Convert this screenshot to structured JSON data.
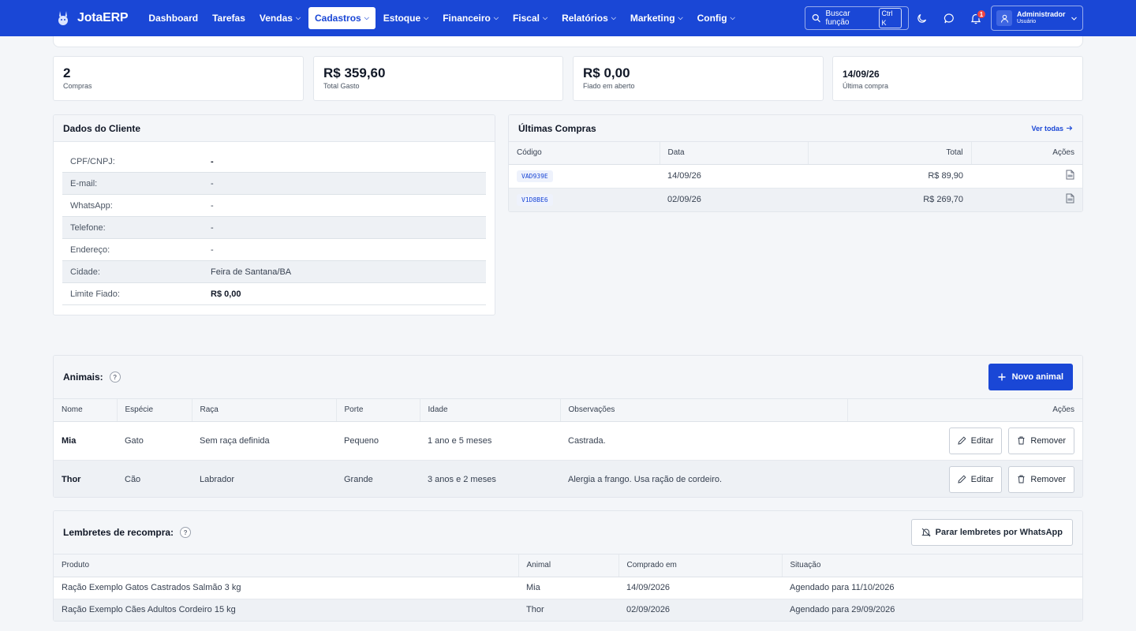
{
  "brand": {
    "name": "JotaERP"
  },
  "nav": {
    "items": [
      {
        "label": "Dashboard",
        "has_menu": false,
        "active": false
      },
      {
        "label": "Tarefas",
        "has_menu": false,
        "active": false
      },
      {
        "label": "Vendas",
        "has_menu": true,
        "active": false
      },
      {
        "label": "Cadastros",
        "has_menu": true,
        "active": true
      },
      {
        "label": "Estoque",
        "has_menu": true,
        "active": false
      },
      {
        "label": "Financeiro",
        "has_menu": true,
        "active": false
      },
      {
        "label": "Fiscal",
        "has_menu": true,
        "active": false
      },
      {
        "label": "Relatórios",
        "has_menu": true,
        "active": false
      },
      {
        "label": "Marketing",
        "has_menu": true,
        "active": false
      },
      {
        "label": "Config",
        "has_menu": true,
        "active": false
      }
    ],
    "search_label": "Buscar função",
    "search_shortcut": "Ctrl K",
    "notifications_count": "1",
    "user_name": "Administrador",
    "user_role": "Usuário"
  },
  "stats": [
    {
      "value": "2",
      "label": "Compras"
    },
    {
      "value": "R$ 359,60",
      "label": "Total Gasto"
    },
    {
      "value": "R$ 0,00",
      "label": "Fiado em aberto"
    },
    {
      "value": "14/09/26",
      "label": "Última compra"
    }
  ],
  "client": {
    "title": "Dados do Cliente",
    "fields": [
      {
        "key": "CPF/CNPJ:",
        "value": "-",
        "bold": true
      },
      {
        "key": "E-mail:",
        "value": "-",
        "bold": false
      },
      {
        "key": "WhatsApp:",
        "value": "-",
        "bold": false
      },
      {
        "key": "Telefone:",
        "value": "-",
        "bold": false
      },
      {
        "key": "Endereço:",
        "value": "-",
        "bold": false
      },
      {
        "key": "Cidade:",
        "value": "Feira de Santana/BA",
        "bold": false
      },
      {
        "key": "Limite Fiado:",
        "value": "R$ 0,00",
        "bold": true
      }
    ]
  },
  "purchases": {
    "title": "Últimas Compras",
    "see_all": "Ver todas",
    "columns": [
      "Código",
      "Data",
      "Total",
      "Ações"
    ],
    "rows": [
      {
        "code": "VAD939E",
        "date": "14/09/26",
        "total": "R$ 89,90"
      },
      {
        "code": "V1D8BE6",
        "date": "02/09/26",
        "total": "R$ 269,70"
      }
    ]
  },
  "animals": {
    "title": "Animais:",
    "add_button": "Novo animal",
    "columns": [
      "Nome",
      "Espécie",
      "Raça",
      "Porte",
      "Idade",
      "Observações",
      "Ações"
    ],
    "edit_label": "Editar",
    "remove_label": "Remover",
    "rows": [
      {
        "name": "Mia",
        "species": "Gato",
        "breed": "Sem raça definida",
        "size": "Pequeno",
        "age": "1 ano e 5 meses",
        "notes": "Castrada."
      },
      {
        "name": "Thor",
        "species": "Cão",
        "breed": "Labrador",
        "size": "Grande",
        "age": "3 anos e 2 meses",
        "notes": "Alergia a frango. Usa ração de cordeiro."
      }
    ]
  },
  "reminders": {
    "title": "Lembretes de recompra:",
    "stop_button": "Parar lembretes por WhatsApp",
    "columns": [
      "Produto",
      "Animal",
      "Comprado em",
      "Situação"
    ],
    "rows": [
      {
        "product": "Ração Exemplo Gatos Castrados Salmão 3 kg",
        "animal": "Mia",
        "bought": "14/09/2026",
        "status": "Agendado para 11/10/2026"
      },
      {
        "product": "Ração Exemplo Cães Adultos Cordeiro 15 kg",
        "animal": "Thor",
        "bought": "02/09/2026",
        "status": "Agendado para 29/09/2026"
      }
    ]
  },
  "colors": {
    "primary": "#1a47d6",
    "badge": "#ef4444"
  }
}
